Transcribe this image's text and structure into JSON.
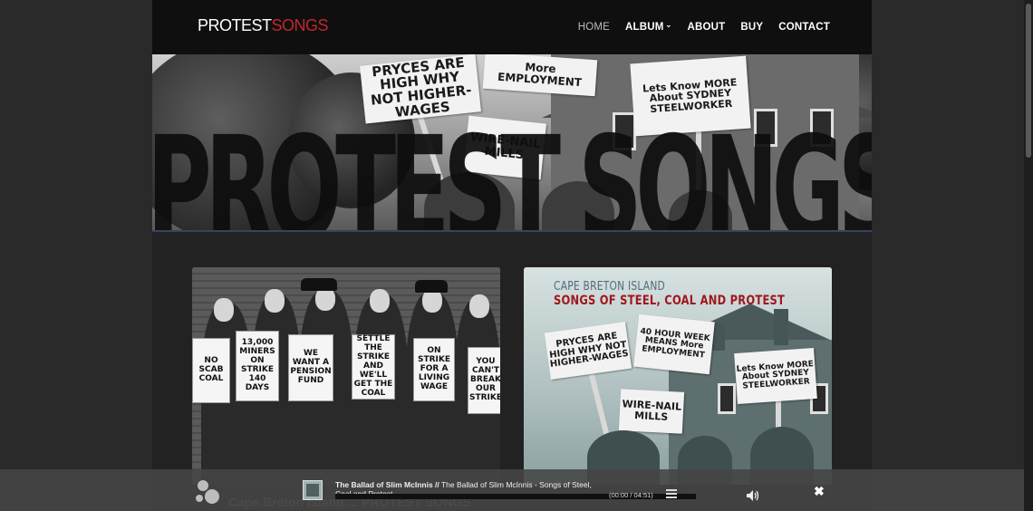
{
  "header": {
    "logo_part1": "PROTEST",
    "logo_part2": "SONGS",
    "nav": [
      {
        "label": "HOME",
        "active": true
      },
      {
        "label": "ALBUM",
        "has_dropdown": true
      },
      {
        "label": "ABOUT"
      },
      {
        "label": "BUY"
      },
      {
        "label": "CONTACT"
      }
    ]
  },
  "banner": {
    "title": "PROTEST SONGS",
    "signs": [
      "PRYCES ARE HIGH WHY NOT HIGHER-WAGES",
      "More EMPLOYMENT",
      "Lets Know MORE About SYDNEY STEELWORKER",
      "WIRE-NAIL MILLS"
    ]
  },
  "cards": {
    "left": {
      "signs": [
        "NO SCAB COAL",
        "13,000 MINERS ON STRIKE 140 DAYS",
        "WE WANT A PENSION FUND",
        "SETTLE THE STRIKE AND WE'LL GET THE COAL",
        "ON STRIKE FOR A LIVING WAGE",
        "YOU CAN'T BREAK OUR STRIKE"
      ]
    },
    "right": {
      "title_line1": "CAPE BRETON ISLAND",
      "title_line2": "SONGS OF STEEL, COAL AND PROTEST",
      "signs": [
        "PRYCES ARE HIGH WHY NOT HIGHER-WAGES",
        "40 HOUR WEEK MEANS More EMPLOYMENT",
        "Lets Know MORE About SYDNEY STEELWORKER",
        "WIRE-NAIL MILLS"
      ]
    }
  },
  "player": {
    "track_title": "The Ballad of Slim McInnis //",
    "track_detail": " The Ballad of Slim McInnis - Songs of Steel, Coal and Protest",
    "time": "(00:00 / 04:51)",
    "behind_text": "Cape Breton Island ... PROTEST SONGS"
  },
  "colors": {
    "accent_red": "#c1272d",
    "header_bg": "#0f0f0f"
  }
}
